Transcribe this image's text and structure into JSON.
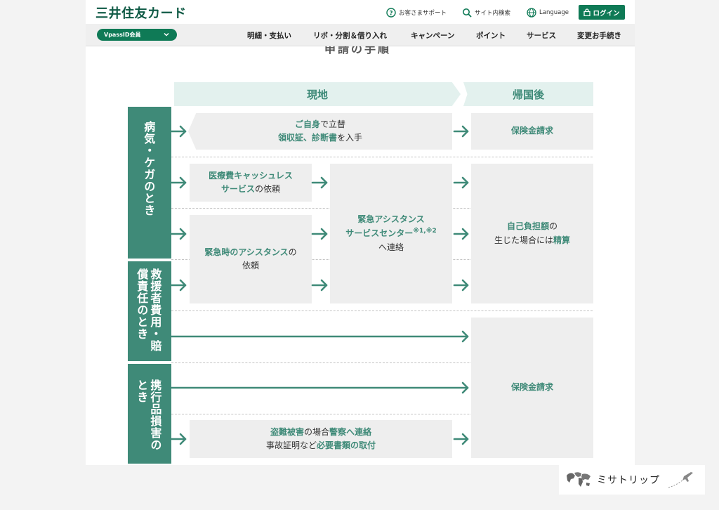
{
  "header": {
    "logo": "三井住友カード",
    "support": "お客さまサポート",
    "site_search": "サイト内検索",
    "language": "Language",
    "login": "ログイン"
  },
  "nav": {
    "member_select": "VpassID会員",
    "items": [
      "明細・支払い",
      "リボ・分割＆借り入れ",
      "キャンペーン",
      "ポイント",
      "サービス",
      "変更お手続き"
    ]
  },
  "section_title_partial": "申請の手順",
  "diagram": {
    "col_local": "現地",
    "col_return": "帰国後",
    "categories": {
      "illness": "病気・ケガのとき",
      "rescue": "救援者費用・賠償責任のとき",
      "belongings": "携行品損害のとき"
    },
    "self_pay": {
      "part1": "ご自身",
      "part2": "で立替",
      "part3": "領収証、診断書",
      "part4": "を入手"
    },
    "cashless": {
      "part1": "医療費キャッシュレス",
      "part2": "サービス",
      "part3": "の依頼"
    },
    "emergency": {
      "part1": "緊急時のアシスタンス",
      "part2": "の",
      "part3": "依頼"
    },
    "center": {
      "part1": "緊急アシスタンス",
      "part2": "サービスセンター",
      "note": "※1,※2",
      "part3": "へ連絡"
    },
    "claim1": "保険金請求",
    "self_burden": {
      "part1": "自己負担額",
      "part2": "の",
      "part3": "生じた場合には",
      "part4": "精算"
    },
    "claim2": "保険金請求",
    "theft": {
      "part1": "盗難被害",
      "part2": "の場合",
      "part3": "警察へ連絡",
      "part4": "事故証明など",
      "part5": "必要書類の取付"
    }
  },
  "watermark": {
    "text": "ミサトリップ"
  },
  "colors": {
    "brand": "#0f7a56",
    "teal": "#3f8a78",
    "arrow": "#3f8a78"
  }
}
